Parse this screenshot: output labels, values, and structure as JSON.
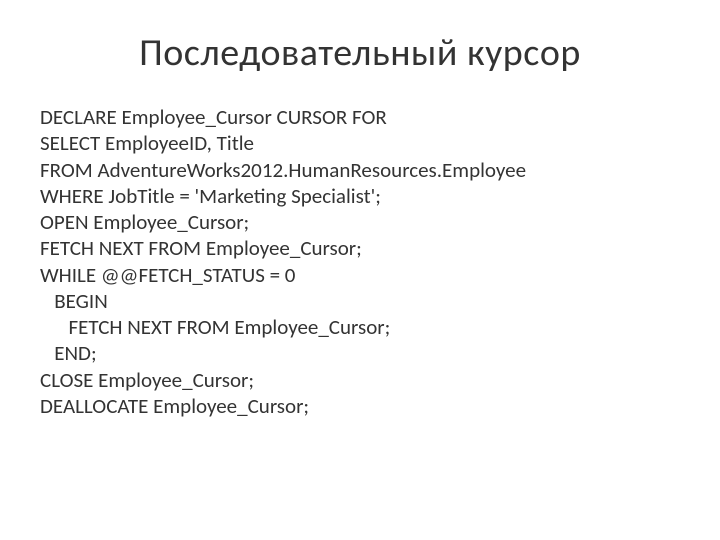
{
  "title": "Последовательный курсор",
  "code": "DECLARE Employee_Cursor CURSOR FOR\nSELECT EmployeeID, Title\nFROM AdventureWorks2012.HumanResources.Employee\nWHERE JobTitle = 'Marketing Specialist';\nOPEN Employee_Cursor;\nFETCH NEXT FROM Employee_Cursor;\nWHILE @@FETCH_STATUS = 0\n   BEGIN\n      FETCH NEXT FROM Employee_Cursor;\n   END;\nCLOSE Employee_Cursor;\nDEALLOCATE Employee_Cursor;"
}
